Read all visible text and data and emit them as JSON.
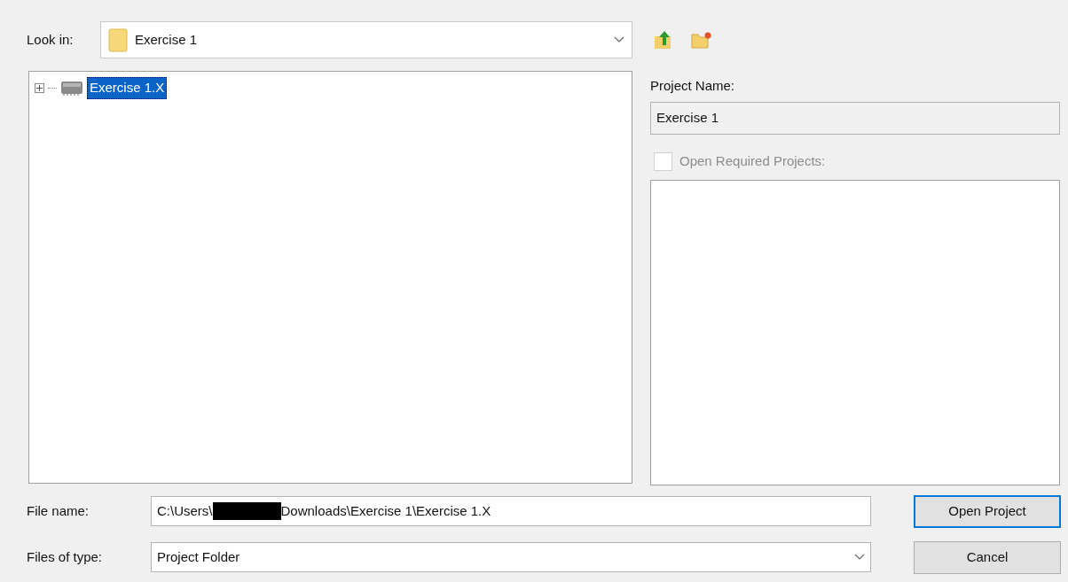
{
  "look_in": {
    "label": "Look in:",
    "value": "Exercise 1"
  },
  "tree": [
    {
      "label": "Exercise 1.X",
      "selected": true,
      "expanded": false
    }
  ],
  "project_name": {
    "label": "Project Name:",
    "value": "Exercise 1"
  },
  "open_required": {
    "label": "Open Required Projects:",
    "checked": false,
    "disabled": true
  },
  "file_name": {
    "label": "File name:",
    "value_before": "C:\\Users\\",
    "redacted": true,
    "value_after": "Downloads\\Exercise 1\\Exercise 1.X"
  },
  "file_type": {
    "label": "Files of type:",
    "value": "Project Folder"
  },
  "buttons": [
    {
      "label": "Open Project",
      "default": true
    },
    {
      "label": "Cancel",
      "default": false
    }
  ]
}
